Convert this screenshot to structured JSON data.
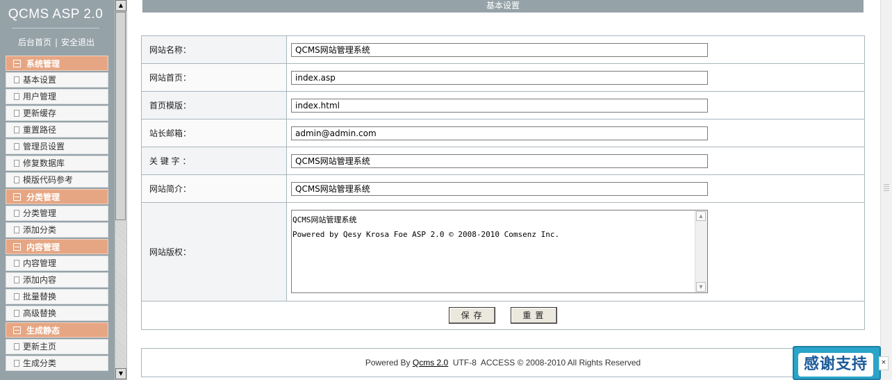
{
  "sidebar": {
    "brand": "QCMS ASP 2.0",
    "links": {
      "home": "后台首页",
      "sep": "|",
      "logout": "安全退出"
    },
    "groups": [
      {
        "title": "系统管理",
        "items": [
          "基本设置",
          "用户管理",
          "更新缓存",
          "重置路径",
          "管理员设置",
          "修复数据库",
          "模版代码参考"
        ]
      },
      {
        "title": "分类管理",
        "items": [
          "分类管理",
          "添加分类"
        ]
      },
      {
        "title": "内容管理",
        "items": [
          "内容管理",
          "添加内容",
          "批量替换",
          "高级替换"
        ]
      },
      {
        "title": "生成静态",
        "items": [
          "更新主页",
          "生成分类"
        ]
      }
    ]
  },
  "header": {
    "title": "基本设置"
  },
  "form": {
    "site_name": {
      "label": "网站名称：",
      "value": "QCMS网站管理系统"
    },
    "site_home": {
      "label": "网站首页：",
      "value": "index.asp"
    },
    "home_template": {
      "label": "首页模版：",
      "value": "index.html"
    },
    "admin_email": {
      "label": "站长邮箱：",
      "value": "admin@admin.com"
    },
    "keywords": {
      "label": "关 键 字 ：",
      "value": "QCMS网站管理系统"
    },
    "description": {
      "label": "网站简介：",
      "value": "QCMS网站管理系统"
    },
    "copyright": {
      "label": "网站版权：",
      "value": "QCMS网站管理系统\nPowered by Qesy Krosa Foe ASP 2.0 © 2008-2010 Comsenz Inc."
    },
    "save_label": "保存",
    "reset_label": "重置"
  },
  "footer": {
    "powered_by": "Powered By ",
    "link": "Qcms 2.0",
    "rest": "  UTF-8  ACCESS © 2008-2010 All Rights Reserved"
  },
  "thanks_badge": "感谢支持",
  "colors": {
    "sidebar_bg": "#95a2a8",
    "group_header": "#e7a683",
    "border": "#a9b5bb"
  }
}
